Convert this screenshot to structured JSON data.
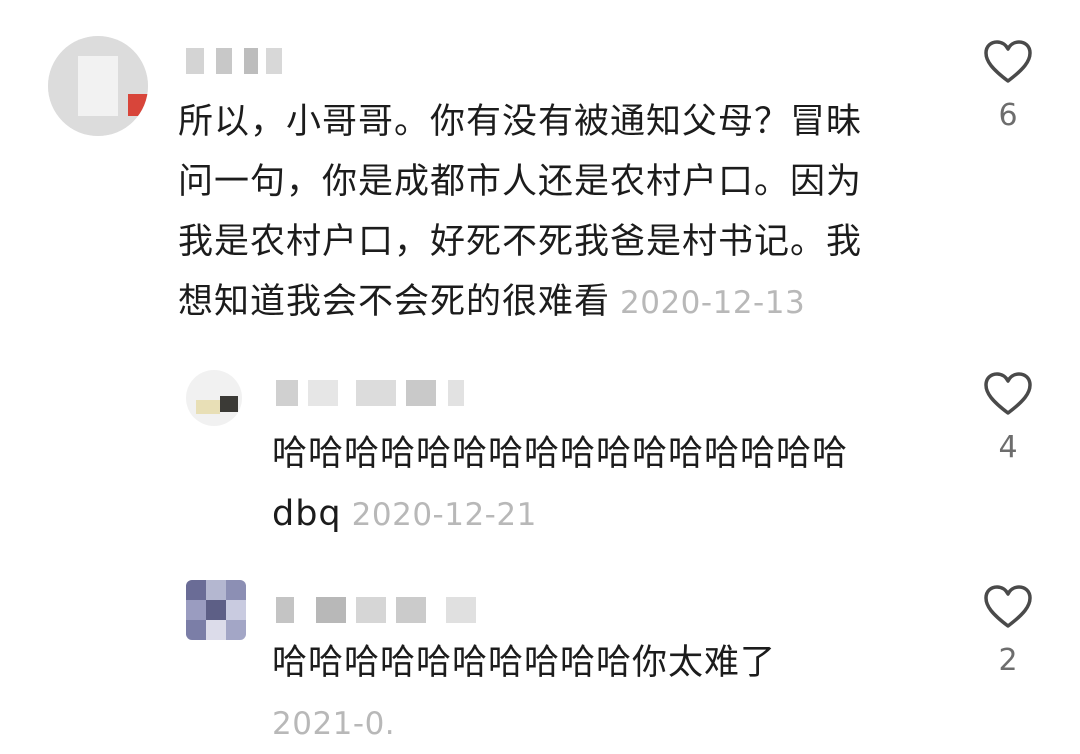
{
  "comments": [
    {
      "text_lines": [
        "所以，小哥哥。你有没有被通知父母？冒昧",
        "问一句，你是成都市人还是农村户口。因为",
        "我是农村户口，好死不死我爸是村书记。我",
        "想知道我会不会死的很难看"
      ],
      "date": "2020-12-13",
      "likes": "6",
      "like_icon": "heart-outline-icon"
    },
    {
      "text_lines": [
        "哈哈哈哈哈哈哈哈哈哈哈哈哈哈哈哈",
        "dbq"
      ],
      "date": "2020-12-21",
      "likes": "4",
      "like_icon": "heart-outline-icon"
    },
    {
      "text_lines": [
        "哈哈哈哈哈哈哈哈哈哈你太难了"
      ],
      "date": "2021-0.",
      "likes": "2",
      "like_icon": "heart-outline-icon"
    }
  ],
  "colors": {
    "text": "#1c1c1c",
    "date": "#b8b8b8",
    "count": "#6d6d6d",
    "heart_stroke": "#4a4a4a"
  }
}
